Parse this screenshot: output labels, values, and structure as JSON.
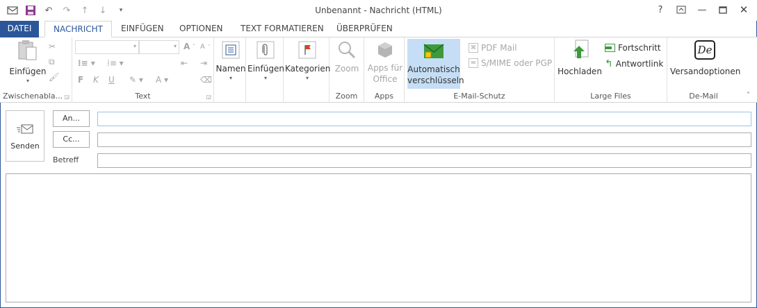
{
  "window": {
    "title": "Unbenannt - Nachricht (HTML)",
    "help": "?"
  },
  "tabs": [
    {
      "label": "DATEI"
    },
    {
      "label": "NACHRICHT"
    },
    {
      "label": "EINFÜGEN"
    },
    {
      "label": "OPTIONEN"
    },
    {
      "label": "TEXT FORMATIEREN"
    },
    {
      "label": "ÜBERPRÜFEN"
    }
  ],
  "ribbon": {
    "clipboard": {
      "paste": "Einfügen",
      "label": "Zwischenabla..."
    },
    "text": {
      "label": "Text"
    },
    "names": {
      "label": "Namen"
    },
    "insert": {
      "label": "Einfügen"
    },
    "categories": {
      "label": "Kategorien"
    },
    "zoom": {
      "button": "Zoom",
      "label": "Zoom"
    },
    "apps": {
      "button_line1": "Apps für",
      "button_line2": "Office",
      "label": "Apps"
    },
    "email_protect": {
      "auto_line1": "Automatisch",
      "auto_line2": "verschlüsseln",
      "pdf": "PDF Mail",
      "smime": "S/MIME oder PGP",
      "label": "E-Mail-Schutz"
    },
    "large_files": {
      "upload": "Hochladen",
      "progress": "Fortschritt",
      "reply_link": "Antwortlink",
      "label": "Large Files"
    },
    "demail": {
      "icon_text": "De",
      "button": "Versandoptionen",
      "label": "De-Mail"
    }
  },
  "compose": {
    "send": "Senden",
    "to_button": "An...",
    "cc_button": "Cc...",
    "subject_label": "Betreff",
    "to_value": "",
    "cc_value": "",
    "subject_value": "",
    "body_value": ""
  },
  "colors": {
    "accent": "#2b579a",
    "selected": "#c5def5"
  }
}
